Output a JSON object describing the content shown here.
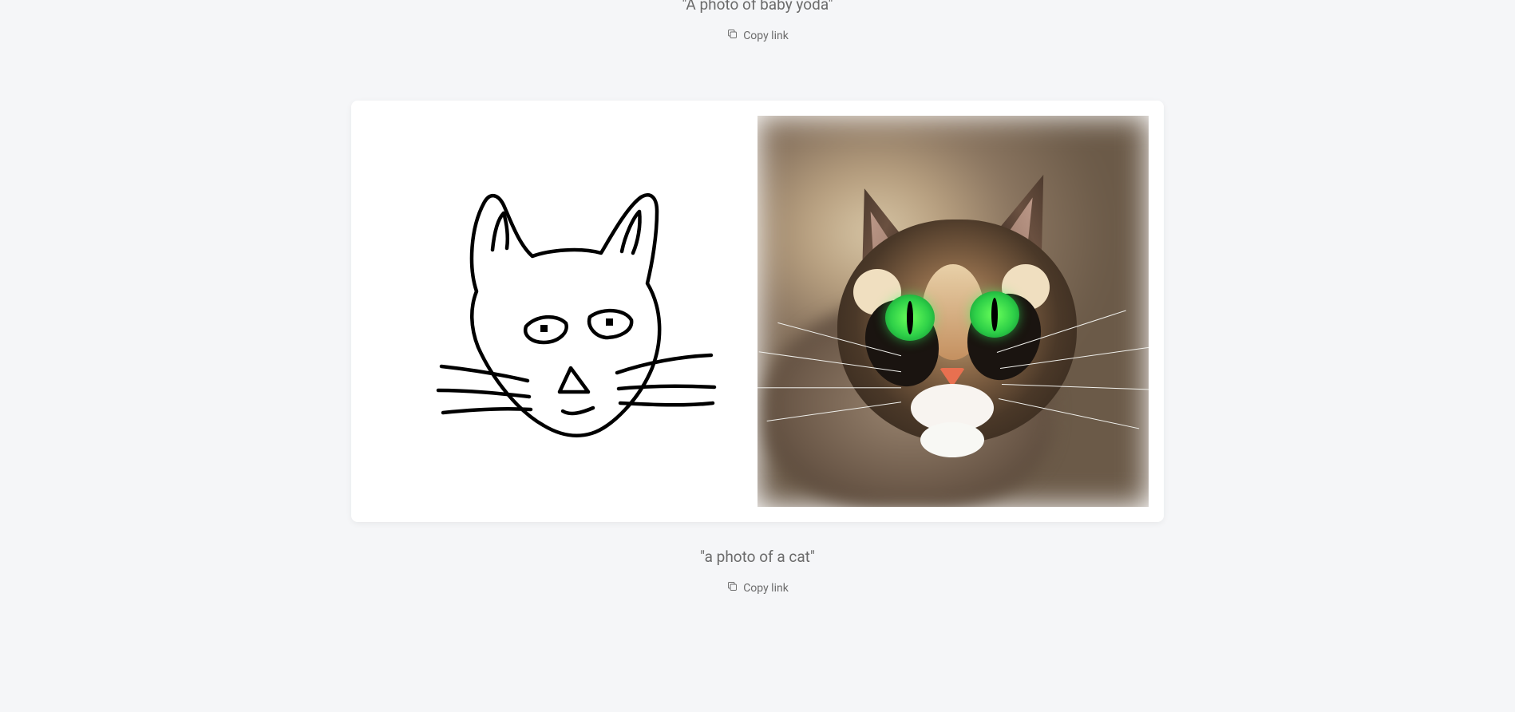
{
  "item1": {
    "caption": "\"A photo of baby yoda\"",
    "copy_label": "Copy link"
  },
  "item2": {
    "caption": "\"a photo of a cat\"",
    "copy_label": "Copy link",
    "sketch_alt": "cat-sketch",
    "photo_alt": "cat-photo"
  }
}
